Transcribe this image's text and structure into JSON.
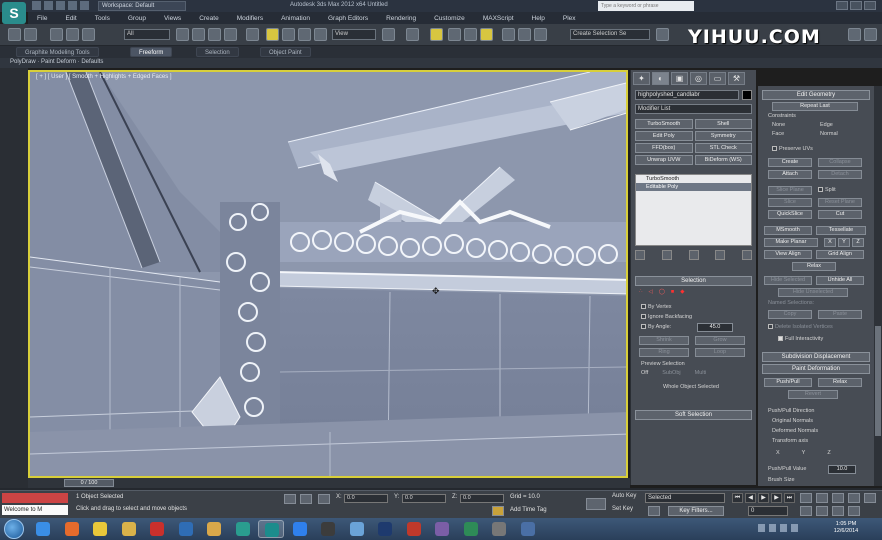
{
  "titlebar": {
    "logo": "S",
    "workspace": "Workspace: Default",
    "window_title": "Autodesk 3ds Max  2012 x64      Untitled",
    "search_placeholder": "Type a keyword or phrase"
  },
  "menubar": [
    "File",
    "Edit",
    "Tools",
    "Group",
    "Views",
    "Create",
    "Modifiers",
    "Animation",
    "Graph Editors",
    "Rendering",
    "Customize",
    "MAXScript",
    "Help",
    "Plex"
  ],
  "watermark": "YIHUU.COM",
  "toolbar": {
    "filter_value": "All",
    "view_value": "View",
    "selection_set_placeholder": "Create Selection Se"
  },
  "ribbon": {
    "tabs": [
      "Graphite Modeling Tools",
      "Freeform",
      "Selection",
      "Object Paint"
    ],
    "active_tab": "Freeform",
    "sub_label": "PolyDraw · Paint Deform · Defaults"
  },
  "viewport": {
    "label": "[ + ] [ User ] [ Smooth + Highlights + Edged Faces ]",
    "border_color": "#d8cf3a",
    "bg_color": "#8d97ad"
  },
  "command_panel": {
    "tab_icons": [
      "create-icon",
      "modify-icon",
      "hierarchy-icon",
      "motion-icon",
      "display-icon",
      "utilities-icon"
    ],
    "object_name": "highpolyshed_candlabr",
    "object_color": "#000000",
    "modifier_list": "Modifier List",
    "modifier_buttons": [
      "TurboSmooth",
      "Shell",
      "Edit Poly",
      "Symmetry",
      "FFD(box)",
      "STL Check",
      "Unwrap UVW",
      "BiDeform (WS)"
    ],
    "stack": [
      "TurboSmooth",
      "Editable Poly"
    ],
    "stack_selected": 1,
    "selection_header": "Selection",
    "by_vertex": "By Vertex",
    "ignore_backfacing": "Ignore Backfacing",
    "by_angle": "By Angle:",
    "angle_value": "45.0",
    "shrink": "Shrink",
    "grow": "Grow",
    "ring": "Ring",
    "loop": "Loop",
    "preview_selection": "Preview Selection",
    "preview_options": [
      "Off",
      "SubObj",
      "Multi"
    ],
    "whole_object": "Whole Object Selected",
    "soft_selection": "Soft Selection"
  },
  "right_panel": {
    "edit_geometry": "Edit Geometry",
    "repeat_last": "Repeat Last",
    "constraints": "Constraints",
    "constraint_options": [
      "None",
      "Edge",
      "Face",
      "Normal"
    ],
    "preserve_uvs": "Preserve UVs",
    "create": "Create",
    "collapse": "Collapse",
    "attach": "Attach",
    "detach": "Detach",
    "slice_plane": "Slice Plane",
    "split": "Split",
    "slice": "Slice",
    "reset_plane": "Reset Plane",
    "quickslice": "QuickSlice",
    "cut": "Cut",
    "msmooth": "MSmooth",
    "tessellate": "Tessellate",
    "make_planar": "Make Planar",
    "xyz": [
      "X",
      "Y",
      "Z"
    ],
    "view_align": "View Align",
    "grid_align": "Grid Align",
    "relax": "Relax",
    "hide_selected": "Hide Selected",
    "unhide_all": "Unhide All",
    "hide_unselected": "Hide Unselected",
    "named_selections": "Named Selections:",
    "copy": "Copy",
    "paste": "Paste",
    "delete_isolated": "Delete Isolated Vertices",
    "full_interactivity": "Full Interactivity",
    "subdivision_displacement": "Subdivision Displacement",
    "paint_deformation": "Paint Deformation",
    "push_pull": "Push/Pull",
    "relax_btn": "Relax",
    "revert": "Revert",
    "push_pull_direction": "Push/Pull Direction",
    "direction_options": [
      "Original Normals",
      "Deformed Normals",
      "Transform axis"
    ],
    "axes": [
      "X",
      "Y",
      "Z"
    ],
    "push_pull_value_label": "Push/Pull Value",
    "push_pull_value": "10.0",
    "brush_size_label": "Brush Size"
  },
  "timeline": {
    "slider": "0 / 100"
  },
  "statusbar": {
    "welcome": "Welcome to M",
    "objects_selected": "1 Object Selected",
    "prompt": "Click and drag to select and move objects",
    "x_label": "X:",
    "x_value": "0.0",
    "y_label": "Y:",
    "y_value": "0.0",
    "z_label": "Z:",
    "z_value": "0.0",
    "grid": "Grid = 10.0",
    "add_time_tag": "Add Time Tag",
    "auto_key": "Auto Key",
    "set_key": "Set Key",
    "selected": "Selected",
    "key_filters": "Key Filters...",
    "frame": "0"
  },
  "taskbar": {
    "apps": [
      "ie-icon",
      "firefox-icon",
      "chrome-icon",
      "explorer-icon",
      "filezilla-icon",
      "app-icon",
      "folder-icon",
      "media-icon",
      "3dsmax-icon",
      "dropbox-icon",
      "unity-icon",
      "notepad-icon",
      "photoshop-icon",
      "app2-icon",
      "app3-icon",
      "app4-icon",
      "app5-icon",
      "app6-icon"
    ],
    "time": "1:05 PM",
    "date": "12/6/2014"
  }
}
